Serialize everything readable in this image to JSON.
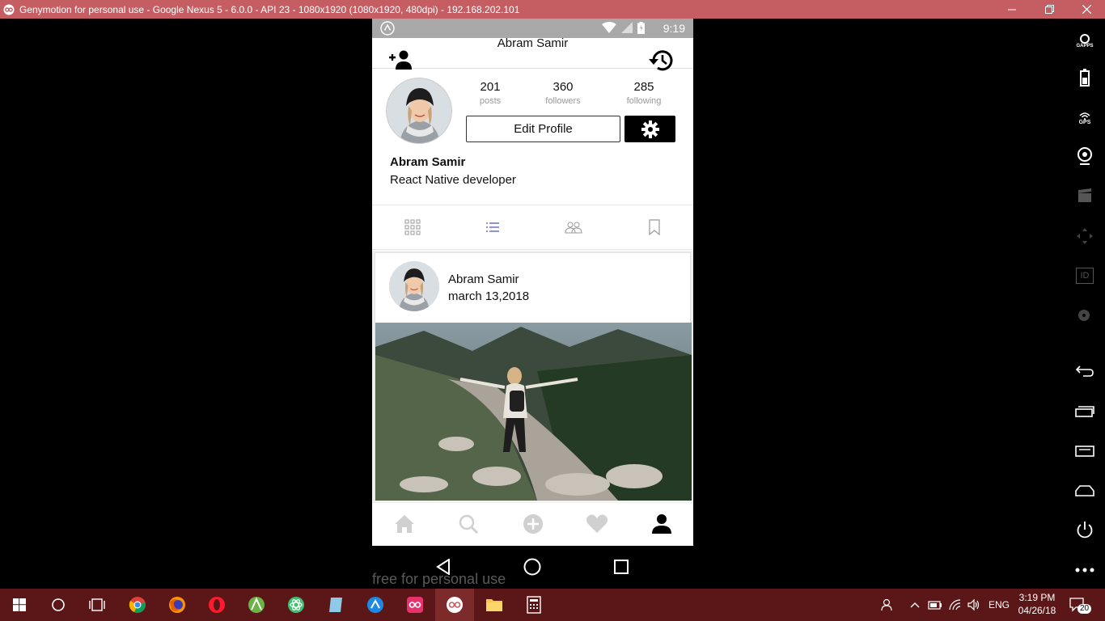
{
  "window": {
    "title": "Genymotion for personal use - Google Nexus 5 - 6.0.0 - API 23 - 1080x1920 (1080x1920, 480dpi) - 192.168.202.101"
  },
  "statusbar": {
    "time": "9:19"
  },
  "appbar": {
    "title": "Abram Samir"
  },
  "profile": {
    "stats": [
      {
        "num": "201",
        "label": "posts"
      },
      {
        "num": "360",
        "label": "followers"
      },
      {
        "num": "285",
        "label": "following"
      }
    ],
    "edit_label": "Edit Profile",
    "name": "Abram Samir",
    "bio": "React Native developer"
  },
  "post": {
    "author": "Abram Samir",
    "date": "march 13,2018"
  },
  "watermark": "free for personal use",
  "taskbar": {
    "language": "ENG",
    "time": "3:19 PM",
    "date": "04/26/18",
    "notifications": "20"
  },
  "sidebar": {
    "gapps": "GAPPS",
    "gps": "GPS",
    "id": "ID"
  },
  "colors": {
    "titlebar": "#c45e63",
    "taskbar": "#5b1717",
    "accent_tab": "#3f51b5"
  }
}
